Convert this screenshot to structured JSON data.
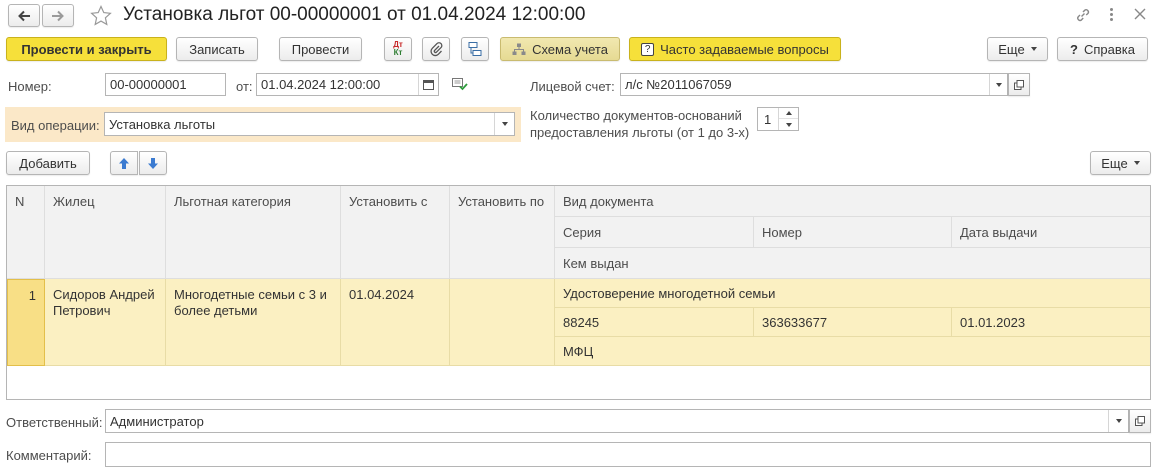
{
  "window": {
    "title": "Установка льгот 00-00000001 от 01.04.2024 12:00:00",
    "nav_back_icon": "arrow-left-icon",
    "nav_forward_icon": "arrow-right-icon",
    "favorite_icon": "star-icon",
    "link_icon": "link-icon",
    "more_icon": "vertical-dots-icon",
    "close_icon": "close-icon"
  },
  "toolbar": {
    "post_and_close": "Провести и закрыть",
    "save": "Записать",
    "post": "Провести",
    "dt_kt": "Дт Кт",
    "accounting_scheme": "Схема учета",
    "faq": "Часто задаваемые вопросы",
    "more": "Еще",
    "help": "Справка",
    "help_mark": "?"
  },
  "header": {
    "number_label": "Номер:",
    "number_value": "00-00000001",
    "date_label": "от:",
    "date_value": "01.04.2024 12:00:00",
    "account_label": "Лицевой счет:",
    "account_value": "л/с №2011067059",
    "operation_label": "Вид операции:",
    "operation_value": "Установка льготы",
    "docs_count_label_1": "Количество документов-оснований",
    "docs_count_label_2": "предоставления льготы (от 1 до 3-х)",
    "docs_count_value": "1"
  },
  "table_toolbar": {
    "add": "Добавить",
    "more": "Еще"
  },
  "table": {
    "headers": {
      "n": "N",
      "resident": "Жилец",
      "category": "Льготная категория",
      "from": "Установить с",
      "to": "Установить по",
      "doc_type": "Вид документа",
      "series": "Серия",
      "number": "Номер",
      "issue_date": "Дата выдачи",
      "issued_by": "Кем выдан"
    },
    "rows": [
      {
        "n": "1",
        "resident_1": "Сидоров Андрей",
        "resident_2": "Петрович",
        "category_1": "Многодетные семьи с 3 и",
        "category_2": "более детьми",
        "from": "01.04.2024",
        "to": "",
        "doc_type": "Удостоверение многодетной семьи",
        "series": "88245",
        "number": "363633677",
        "issue_date": "01.01.2023",
        "issued_by": "МФЦ"
      }
    ]
  },
  "footer": {
    "responsible_label": "Ответственный:",
    "responsible_value": "Администратор",
    "comment_label": "Комментарий:",
    "comment_value": ""
  },
  "colors": {
    "accent_yellow": "#f6e03a",
    "row_selected": "#fbf0c2",
    "header_bg": "#f2f2f2",
    "operation_band": "#fbe8c8"
  }
}
